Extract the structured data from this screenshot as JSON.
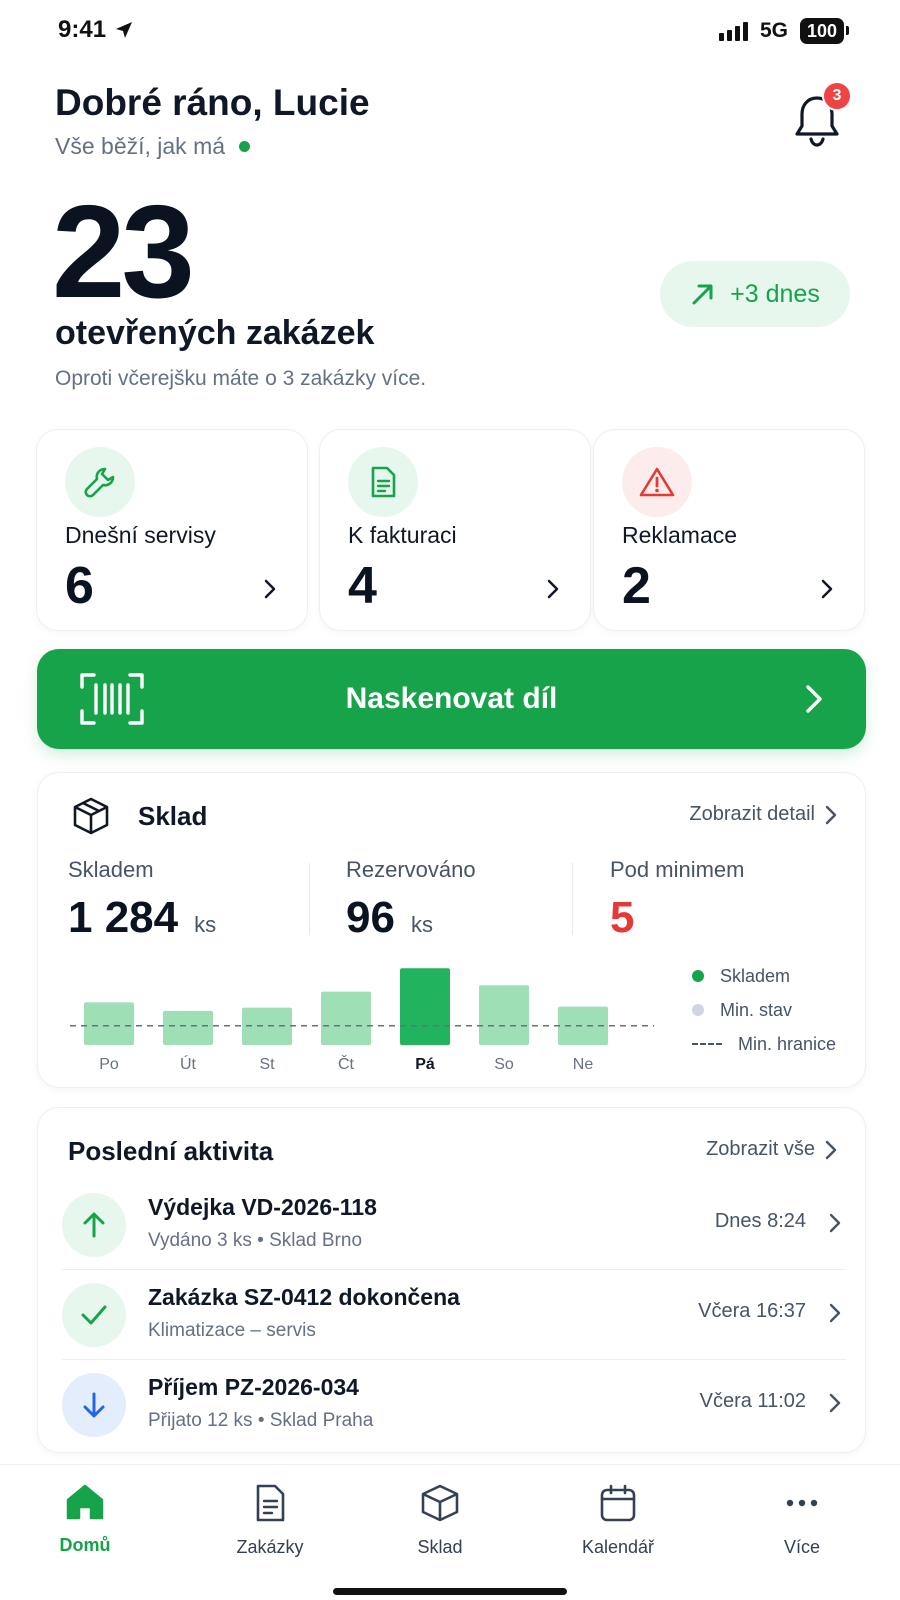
{
  "status_bar": {
    "time": "9:41",
    "network": "5G",
    "battery": "100"
  },
  "header": {
    "greeting": "Dobré ráno, Lucie",
    "status": "Vše běží, jak má",
    "notification_count": "3"
  },
  "hero": {
    "count": "23",
    "label": "otevřených zakázek",
    "subtitle": "Oproti včerejšku máte o 3 zakázky více.",
    "trend": "+3 dnes"
  },
  "stats": [
    {
      "label": "Dnešní servisy",
      "value": "6",
      "icon": "wrench-icon"
    },
    {
      "label": "K fakturaci",
      "value": "4",
      "icon": "document-icon"
    },
    {
      "label": "Reklamace",
      "value": "2",
      "icon": "warning-icon"
    }
  ],
  "scan": {
    "label": "Naskenovat díl",
    "icon": "barcode-scan-icon"
  },
  "sklad": {
    "title": "Sklad",
    "detail_link": "Zobrazit detail",
    "metrics": [
      {
        "label": "Skladem",
        "value": "1 284",
        "unit": "ks"
      },
      {
        "label": "Rezervováno",
        "value": "96",
        "unit": "ks"
      },
      {
        "label": "Pod minimem",
        "value": "5",
        "unit": ""
      }
    ],
    "legend": [
      "Skladem",
      "Min. stav",
      "Min. hranice"
    ]
  },
  "chart_data": {
    "type": "bar",
    "categories": [
      "Po",
      "Út",
      "St",
      "Čt",
      "Pá",
      "So",
      "Ne"
    ],
    "values": [
      40,
      32,
      35,
      50,
      72,
      56,
      36
    ],
    "highlight_index": 4,
    "threshold": 18,
    "ylim": [
      0,
      75
    ],
    "legend": [
      "Skladem",
      "Min. stav",
      "Min. hranice"
    ],
    "grid": false,
    "legend_position": "right",
    "colors": {
      "bar": "#9fdfb6",
      "bar_highlight": "#22b35e",
      "min_stav": "#cfd5e2"
    }
  },
  "activity": {
    "title": "Poslední aktivita",
    "link": "Zobrazit vše",
    "items": [
      {
        "title": "Výdejka VD-2026-118",
        "subtitle": "Vydáno 3 ks • Sklad Brno",
        "time": "Dnes 8:24",
        "icon": "arrow-up-icon"
      },
      {
        "title": "Zakázka SZ-0412 dokončena",
        "subtitle": "Klimatizace – servis",
        "time": "Včera 16:37",
        "icon": "check-icon"
      },
      {
        "title": "Příjem PZ-2026-034",
        "subtitle": "Přijato 12 ks • Sklad Praha",
        "time": "Včera 11:02",
        "icon": "arrow-down-icon"
      }
    ]
  },
  "tabs": [
    {
      "label": "Domů",
      "icon": "home-icon",
      "active": true
    },
    {
      "label": "Zakázky",
      "icon": "document-icon",
      "active": false
    },
    {
      "label": "Sklad",
      "icon": "box-icon",
      "active": false
    },
    {
      "label": "Kalendář",
      "icon": "calendar-icon",
      "active": false
    },
    {
      "label": "Více",
      "icon": "more-icon",
      "active": false
    }
  ],
  "colors": {
    "accent": "#16a34a",
    "danger": "#e53935",
    "info": "#2563eb"
  }
}
